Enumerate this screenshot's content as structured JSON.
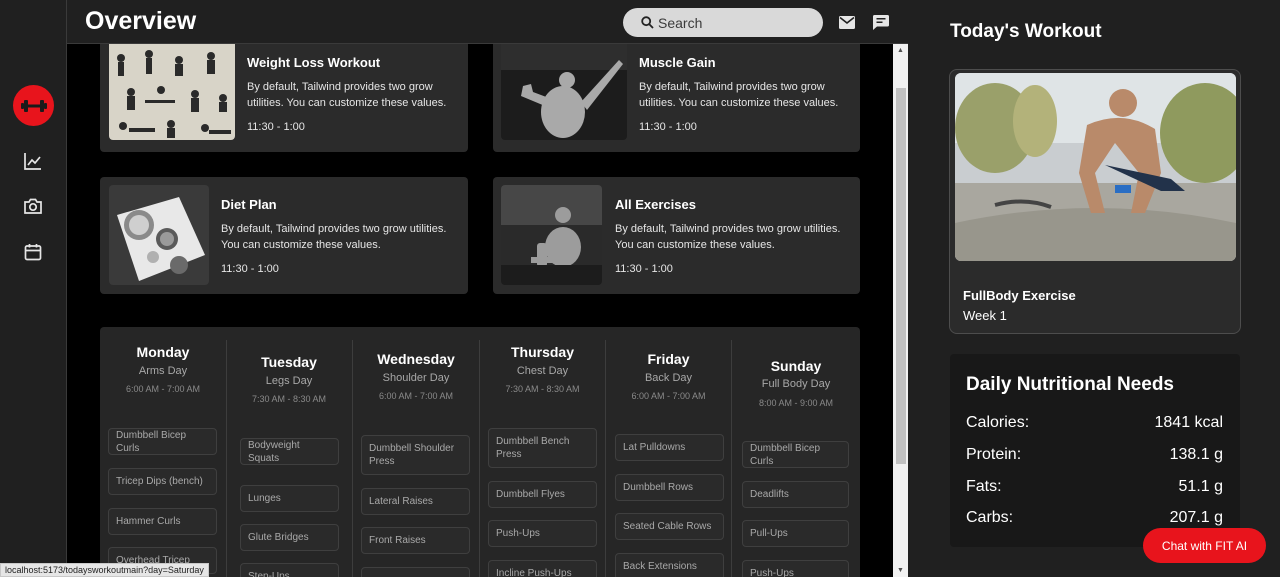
{
  "header": {
    "title": "Overview",
    "search_placeholder": "Search"
  },
  "sidebar": {
    "items": [
      {
        "icon": "dumbbell-icon",
        "active": true
      },
      {
        "icon": "chart-line-icon"
      },
      {
        "icon": "camera-icon"
      },
      {
        "icon": "calendar-icon"
      }
    ]
  },
  "cards": [
    {
      "title": "Weight Loss Workout",
      "desc1": "By default, Tailwind provides two grow",
      "desc2": "utilities. You can customize these values.",
      "time": "11:30 - 1:00"
    },
    {
      "title": "Muscle Gain",
      "desc1": "By default, Tailwind provides two grow",
      "desc2": "utilities. You can customize these values.",
      "time": "11:30 - 1:00"
    },
    {
      "title": "Diet Plan",
      "desc1": "By default, Tailwind provides two grow utilities.",
      "desc2": "You can customize these values.",
      "time": "11:30 - 1:00"
    },
    {
      "title": "All Exercises",
      "desc1": "By default, Tailwind provides two grow utilities.",
      "desc2": "You can customize these values.",
      "time": "11:30 - 1:00"
    }
  ],
  "schedule": [
    {
      "day": "Monday",
      "type": "Arms Day",
      "time": "6:00 AM - 7:00 AM",
      "exercises": [
        "Dumbbell Bicep Curls",
        "Tricep Dips (bench)",
        "Hammer Curls",
        "Overhead Tricep"
      ]
    },
    {
      "day": "Tuesday",
      "type": "Legs Day",
      "time": "7:30 AM - 8:30 AM",
      "exercises": [
        "Bodyweight Squats",
        "Lunges",
        "Glute Bridges",
        "Step-Ups"
      ]
    },
    {
      "day": "Wednesday",
      "type": "Shoulder Day",
      "time": "6:00 AM - 7:00 AM",
      "exercises": [
        "Dumbbell Shoulder Press",
        "Lateral Raises",
        "Front Raises",
        ""
      ]
    },
    {
      "day": "Thursday",
      "type": "Chest Day",
      "time": "7:30 AM - 8:30 AM",
      "exercises": [
        "Dumbbell Bench Press",
        "Dumbbell Flyes",
        "Push-Ups",
        "Incline Push-Ups"
      ]
    },
    {
      "day": "Friday",
      "type": "Back Day",
      "time": "6:00 AM - 7:00 AM",
      "exercises": [
        "Lat Pulldowns",
        "Dumbbell Rows",
        "Seated Cable Rows",
        "Back Extensions"
      ]
    },
    {
      "day": "Sunday",
      "type": "Full Body Day",
      "time": "8:00 AM - 9:00 AM",
      "exercises": [
        "Dumbbell Bicep Curls",
        "Deadlifts",
        "Pull-Ups",
        "Push-Ups"
      ]
    }
  ],
  "today": {
    "heading": "Today's Workout",
    "name": "FullBody Exercise",
    "week": "Week 1"
  },
  "nutrition": {
    "heading": "Daily Nutritional Needs",
    "rows": [
      {
        "label": "Calories:",
        "value": "1841 kcal"
      },
      {
        "label": "Protein:",
        "value": "138.1 g"
      },
      {
        "label": "Fats:",
        "value": "51.1 g"
      },
      {
        "label": "Carbs:",
        "value": "207.1 g"
      }
    ]
  },
  "chat": {
    "label": "Chat with FIT AI"
  },
  "status_url": "localhost:5173/todaysworkoutmain?day=Saturday",
  "colors": {
    "accent": "#e8141c",
    "panel": "#202020",
    "card": "#2b2b2b"
  }
}
